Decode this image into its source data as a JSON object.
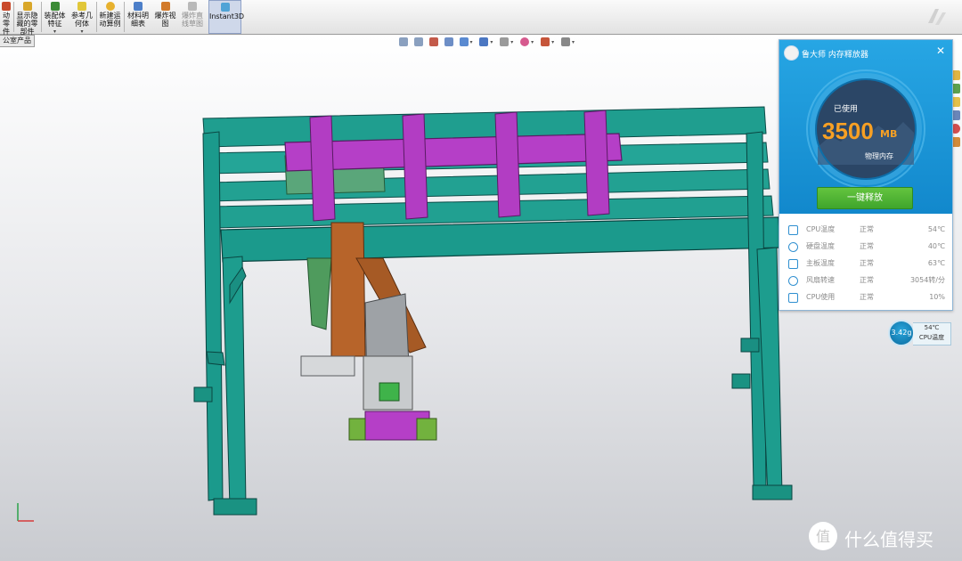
{
  "toolbar": {
    "buttons": [
      {
        "label": "动零\n件",
        "has_dropdown": false
      },
      {
        "label": "显示隐\n藏的零\n部件",
        "has_dropdown": false
      },
      {
        "label": "装配体\n特征",
        "has_dropdown": true
      },
      {
        "label": "参考几\n何体",
        "has_dropdown": true
      },
      {
        "label": "新建运\n动算例",
        "has_dropdown": false
      },
      {
        "label": "材料明\n细表",
        "has_dropdown": false
      },
      {
        "label": "爆炸视\n图",
        "has_dropdown": false
      },
      {
        "label": "爆炸直\n线草图",
        "has_dropdown": false
      },
      {
        "label": "Instant3D",
        "has_dropdown": false
      }
    ]
  },
  "viewport": {
    "feature_tab": "公室产品"
  },
  "memory_widget": {
    "title": "鲁大师 内存释放器",
    "used_label": "已使用",
    "used_value": "3500",
    "used_unit": "MB",
    "physical_label": "物理内存",
    "release_button": "一键释放",
    "stats": [
      {
        "name": "CPU温度",
        "status": "正常",
        "value": "54℃"
      },
      {
        "name": "硬盘温度",
        "status": "正常",
        "value": "40℃"
      },
      {
        "name": "主板温度",
        "status": "正常",
        "value": "63℃"
      },
      {
        "name": "风扇转速",
        "status": "正常",
        "value": "3054转/分"
      },
      {
        "name": "CPU使用",
        "status": "正常",
        "value": "10%"
      }
    ]
  },
  "temp_badge": {
    "memory": "3.42g",
    "temp": "54℃",
    "label": "CPU温度"
  },
  "watermark": {
    "icon_text": "值",
    "text": "什么值得买"
  },
  "colors": {
    "frame": "#1a9f8f",
    "purple_beam": "#b23fc4",
    "widget_blue": "#1b96d8",
    "release_green": "#4cb233",
    "memory_orange": "#f7a024"
  }
}
